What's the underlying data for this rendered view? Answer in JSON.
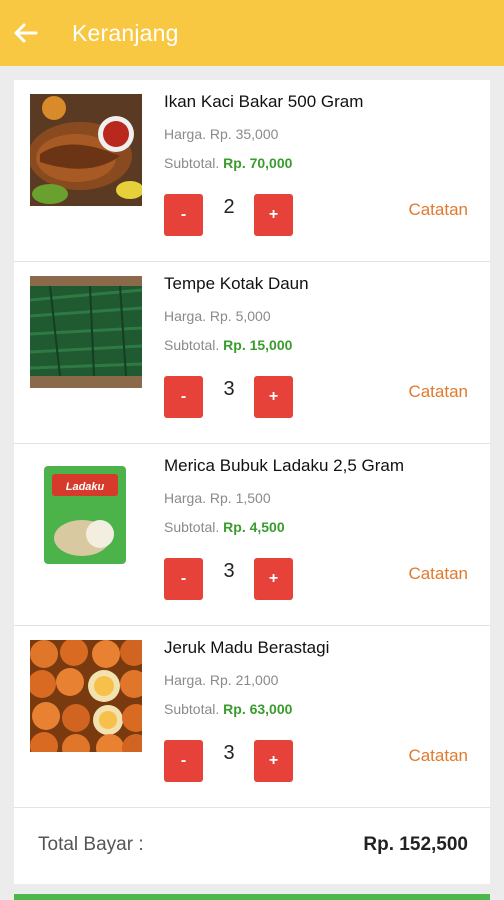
{
  "appbar": {
    "title": "Keranjang",
    "back_icon": "arrow-left-icon",
    "color": "#f9c842"
  },
  "items": [
    {
      "name": "Ikan Kaci Bakar 500 Gram",
      "price": "Harga. Rp. 35,000",
      "subtotal_label": "Subtotal.",
      "subtotal_value": "Rp. 70,000",
      "qty": "2",
      "minus": "-",
      "plus": "+",
      "note": "Catatan"
    },
    {
      "name": "Tempe Kotak Daun",
      "price": "Harga. Rp. 5,000",
      "subtotal_label": "Subtotal.",
      "subtotal_value": "Rp. 15,000",
      "qty": "3",
      "minus": "-",
      "plus": "+",
      "note": "Catatan"
    },
    {
      "name": "Merica Bubuk Ladaku 2,5 Gram",
      "price": "Harga. Rp. 1,500",
      "subtotal_label": "Subtotal.",
      "subtotal_value": "Rp. 4,500",
      "qty": "3",
      "minus": "-",
      "plus": "+",
      "note": "Catatan",
      "package_text": "Ladaku"
    },
    {
      "name": "Jeruk Madu Berastagi",
      "price": "Harga. Rp. 21,000",
      "subtotal_label": "Subtotal.",
      "subtotal_value": "Rp. 63,000",
      "qty": "3",
      "minus": "-",
      "plus": "+",
      "note": "Catatan"
    }
  ],
  "total": {
    "label": "Total Bayar :",
    "value": "Rp. 152,500"
  },
  "colors": {
    "accent": "#e6423a",
    "subtotal": "#3a9b2e",
    "note": "#e07a2e"
  }
}
